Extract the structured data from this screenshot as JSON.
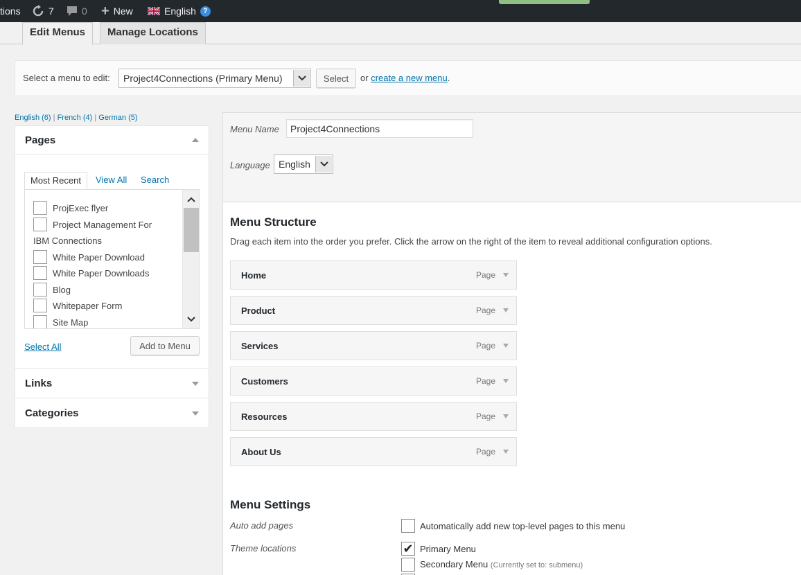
{
  "adminbar": {
    "site_fragment": "tions",
    "updates_count": "7",
    "comments_count": "0",
    "new_label": "New",
    "language_label": "English"
  },
  "tabs": [
    {
      "label": "Edit Menus",
      "active": true
    },
    {
      "label": "Manage Locations",
      "active": false
    }
  ],
  "selectbar": {
    "label": "Select a menu to edit:",
    "selected_menu": "Project4Connections (Primary Menu)",
    "select_button": "Select",
    "or_text": "or",
    "create_link": "create a new menu",
    "period": "."
  },
  "language_links": [
    {
      "label": "English (6)"
    },
    {
      "label": "French (4)"
    },
    {
      "label": "German (5)"
    }
  ],
  "language_sep": "|",
  "pages_panel": {
    "title": "Pages",
    "tabs": [
      "Most Recent",
      "View All",
      "Search"
    ],
    "items": [
      {
        "label": "ProjExec flyer",
        "checkbox": true
      },
      {
        "label": "Project Management For",
        "checkbox": true
      },
      {
        "label": "IBM Connections",
        "checkbox": false
      },
      {
        "label": "White Paper Download",
        "checkbox": true
      },
      {
        "label": "White Paper Downloads",
        "checkbox": true
      },
      {
        "label": "Blog",
        "checkbox": true
      },
      {
        "label": "Whitepaper Form",
        "checkbox": true
      },
      {
        "label": "Site Map",
        "checkbox": true
      }
    ],
    "select_all": "Select All",
    "add_button": "Add to Menu"
  },
  "links_panel": {
    "title": "Links"
  },
  "categories_panel": {
    "title": "Categories"
  },
  "menu_header": {
    "name_label": "Menu Name",
    "name_value": "Project4Connections",
    "language_label": "Language",
    "language_value": "English"
  },
  "menu_structure": {
    "title": "Menu Structure",
    "description": "Drag each item into the order you prefer. Click the arrow on the right of the item to reveal additional configuration options.",
    "items": [
      {
        "label": "Home",
        "type": "Page"
      },
      {
        "label": "Product",
        "type": "Page"
      },
      {
        "label": "Services",
        "type": "Page"
      },
      {
        "label": "Customers",
        "type": "Page"
      },
      {
        "label": "Resources",
        "type": "Page"
      },
      {
        "label": "About Us",
        "type": "Page"
      }
    ]
  },
  "menu_settings": {
    "title": "Menu Settings",
    "auto_add_label": "Auto add pages",
    "auto_add_text": "Automatically add new top-level pages to this menu",
    "auto_add_checked": false,
    "theme_locations_label": "Theme locations",
    "primary_text": "Primary Menu",
    "primary_checked": true,
    "secondary_text": "Secondary Menu",
    "secondary_note": "(Currently set to: submenu)",
    "secondary_checked": false
  },
  "colors": {
    "adminbar_bg": "#23282d",
    "link": "#0073aa",
    "panel_bg": "#f1f1f1"
  }
}
